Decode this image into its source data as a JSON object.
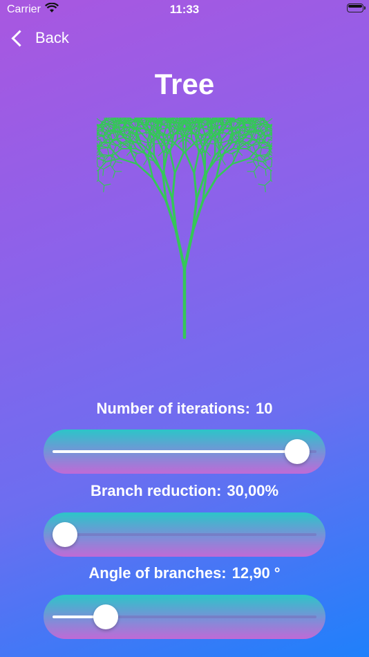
{
  "status": {
    "carrier": "Carrier",
    "time": "11:33"
  },
  "nav": {
    "back_label": "Back"
  },
  "page": {
    "title": "Tree"
  },
  "colors": {
    "tree": "#35c758",
    "thumb": "#ffffff"
  },
  "controls": [
    {
      "label": "Number of iterations:",
      "value": "10",
      "fraction": 0.97
    },
    {
      "label": "Branch reduction:",
      "value": "30,00%",
      "fraction": 0.0
    },
    {
      "label": "Angle of branches:",
      "value": "12,90  °",
      "fraction": 0.17
    }
  ],
  "icons": [
    "wifi-icon",
    "battery-icon",
    "chevron-left-icon"
  ]
}
